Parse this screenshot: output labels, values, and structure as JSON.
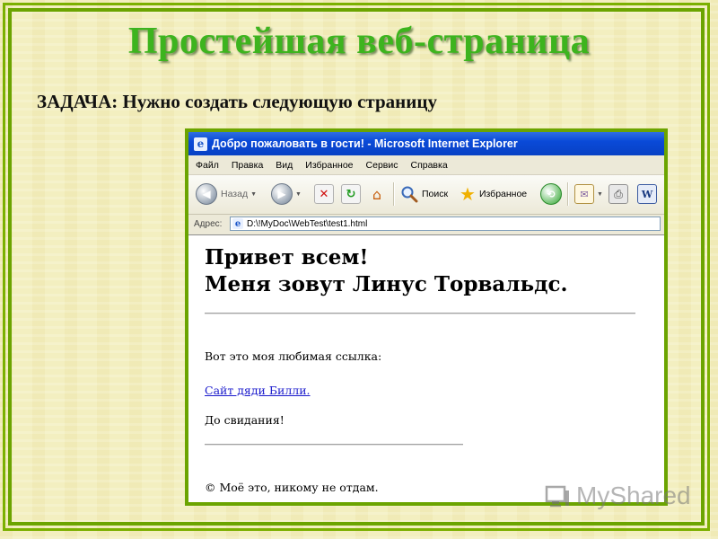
{
  "slide": {
    "title": "Простейшая веб-страница",
    "task": "ЗАДАЧА: Нужно создать следующую страницу"
  },
  "browser": {
    "window_title": "Добро пожаловать в гости! - Microsoft Internet Explorer",
    "menu": [
      "Файл",
      "Правка",
      "Вид",
      "Избранное",
      "Сервис",
      "Справка"
    ],
    "toolbar": {
      "back_label": "Назад",
      "search_label": "Поиск",
      "favorites_label": "Избранное"
    },
    "address_label": "Адрес:",
    "address_value": "D:\\!MyDoc\\WebTest\\test1.html"
  },
  "page": {
    "heading_line1": "Привет всем!",
    "heading_line2": "Меня зовут Линус Торвальдс.",
    "favorite_link_intro": "Вот это моя любимая ссылка:",
    "favorite_link_text": "Сайт дяди Билли.",
    "goodbye": "До свидания!",
    "copyright": "© Моё это, никому не отдам."
  },
  "watermark": {
    "text": "MyShared"
  },
  "colors": {
    "title_green": "#3db41e",
    "frame_green": "#6ba400",
    "ie_titlebar_blue": "#0a4ad8",
    "link_blue": "#1a1acc"
  }
}
